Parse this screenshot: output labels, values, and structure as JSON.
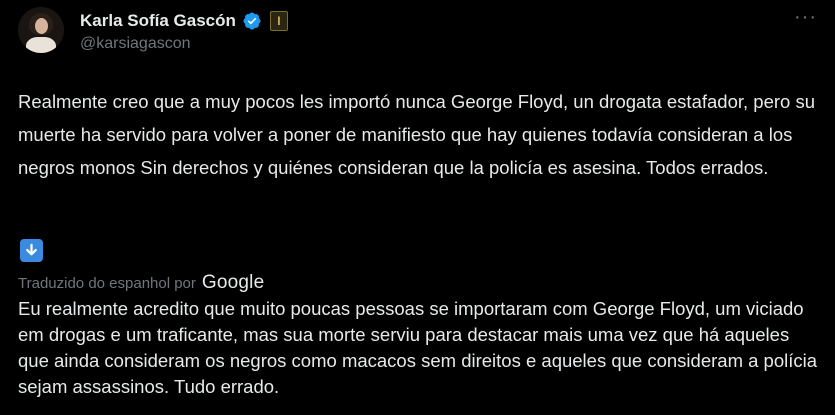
{
  "author": {
    "display_name": "Karla Sofía Gascón",
    "handle": "@karsiagascon",
    "affiliation_badge": "I"
  },
  "icons": {
    "verified": "verified-badge-icon",
    "more": "more-options-icon",
    "translate": "translate-arrow-icon"
  },
  "more_label": "···",
  "tweet": {
    "original_text": "Realmente creo que a muy pocos les importó nunca George Floyd, un drogata estafador, pero su muerte ha servido para volver a poner de manifiesto que hay quienes todavía consideran a los negros monos Sin derechos y quiénes consideran que la policía es asesina. Todos errados."
  },
  "translation": {
    "label": "Traduzido do espanhol por",
    "provider": "Google",
    "text": "Eu realmente acredito que muito poucas pessoas se importaram com George Floyd, um viciado em drogas e um traficante, mas sua morte serviu para destacar mais uma vez que há aqueles que ainda consideram os negros como macacos sem direitos e aqueles que consideram a polícia sejam assassinos. Tudo errado."
  },
  "colors": {
    "background": "#000000",
    "text": "#e7e9ea",
    "secondary": "#71767b",
    "verified": "#1d9bf0",
    "translate_icon": "#3a8be0"
  }
}
